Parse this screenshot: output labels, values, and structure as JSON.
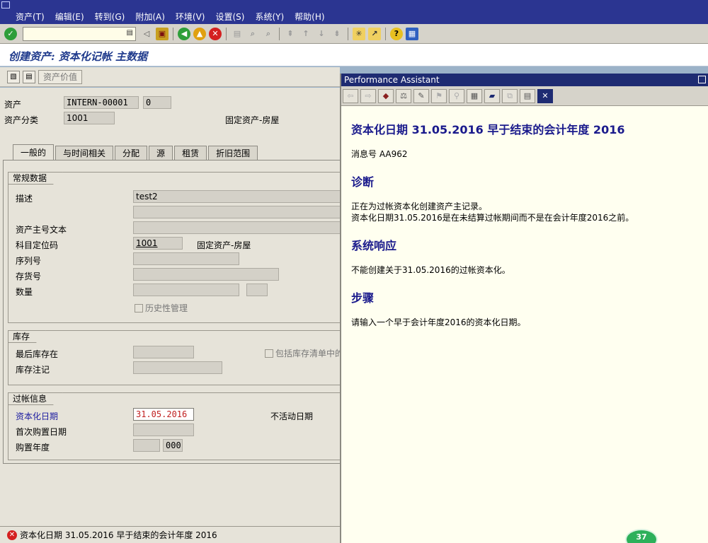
{
  "menu": [
    "资产(T)",
    "编辑(E)",
    "转到(G)",
    "附加(A)",
    "环境(V)",
    "设置(S)",
    "系统(Y)",
    "帮助(H)"
  ],
  "toolbar": {
    "command_value": ""
  },
  "title": "创建资产: 资本化记帐 主数据",
  "app_toolbar": {
    "asset_values_label": "资产价值"
  },
  "header": {
    "asset_label": "资产",
    "asset_value": "INTERN-00001",
    "subnumber": "0",
    "asset_class_label": "资产分类",
    "asset_class_value": "1001",
    "asset_class_desc": "固定资产-房屋"
  },
  "tabs": [
    "一般的",
    "与时间相关",
    "分配",
    "源",
    "租赁",
    "折旧范围"
  ],
  "general_data": {
    "title": "常规数据",
    "description_label": "描述",
    "description_value": "test2",
    "description2_value": "",
    "main_text_label": "资产主号文本",
    "main_text_value": "",
    "account_det_label": "科目定位码",
    "account_det_value": "1001",
    "account_det_desc": "固定资产-房屋",
    "serial_label": "序列号",
    "inventory_no_label": "存货号",
    "quantity_label": "数量",
    "history_label": "历史性管理"
  },
  "inventory": {
    "title": "库存",
    "last_inventory_label": "最后库存在",
    "include_list_label": "包括库存清单中的",
    "inventory_note_label": "库存注记"
  },
  "posting_info": {
    "title": "过帐信息",
    "cap_date_label": "资本化日期",
    "cap_date_value": "31.05.2016",
    "deactivation_label": "不活动日期",
    "first_acq_label": "首次购置日期",
    "acq_year_label": "购置年度",
    "acq_period_value": "000"
  },
  "status": {
    "message": "资本化日期 31.05.2016 早于结束的会计年度 2016"
  },
  "assistant": {
    "window_title": "Performance Assistant",
    "heading": "资本化日期  31.05.2016 早于结束的会计年度  2016",
    "msg_no": "消息号  AA962",
    "diagnosis_title": "诊断",
    "diagnosis_line1": "正在为过帐资本化创建资产主记录。",
    "diagnosis_line2": "资本化日期31.05.2016是在未结算过帐期间而不是在会计年度2016之前。",
    "response_title": "系统响应",
    "response_text": "不能创建关于31.05.2016的过帐资本化。",
    "procedure_title": "步骤",
    "procedure_text": "请输入一个早于会计年度2016的资本化日期。"
  },
  "badge": {
    "value": "37"
  },
  "colors": {
    "menu_bg": "#2b3591",
    "title_text": "#1f3a8c",
    "assistant_heading": "#1a1a8c",
    "error_red": "#d42020"
  }
}
